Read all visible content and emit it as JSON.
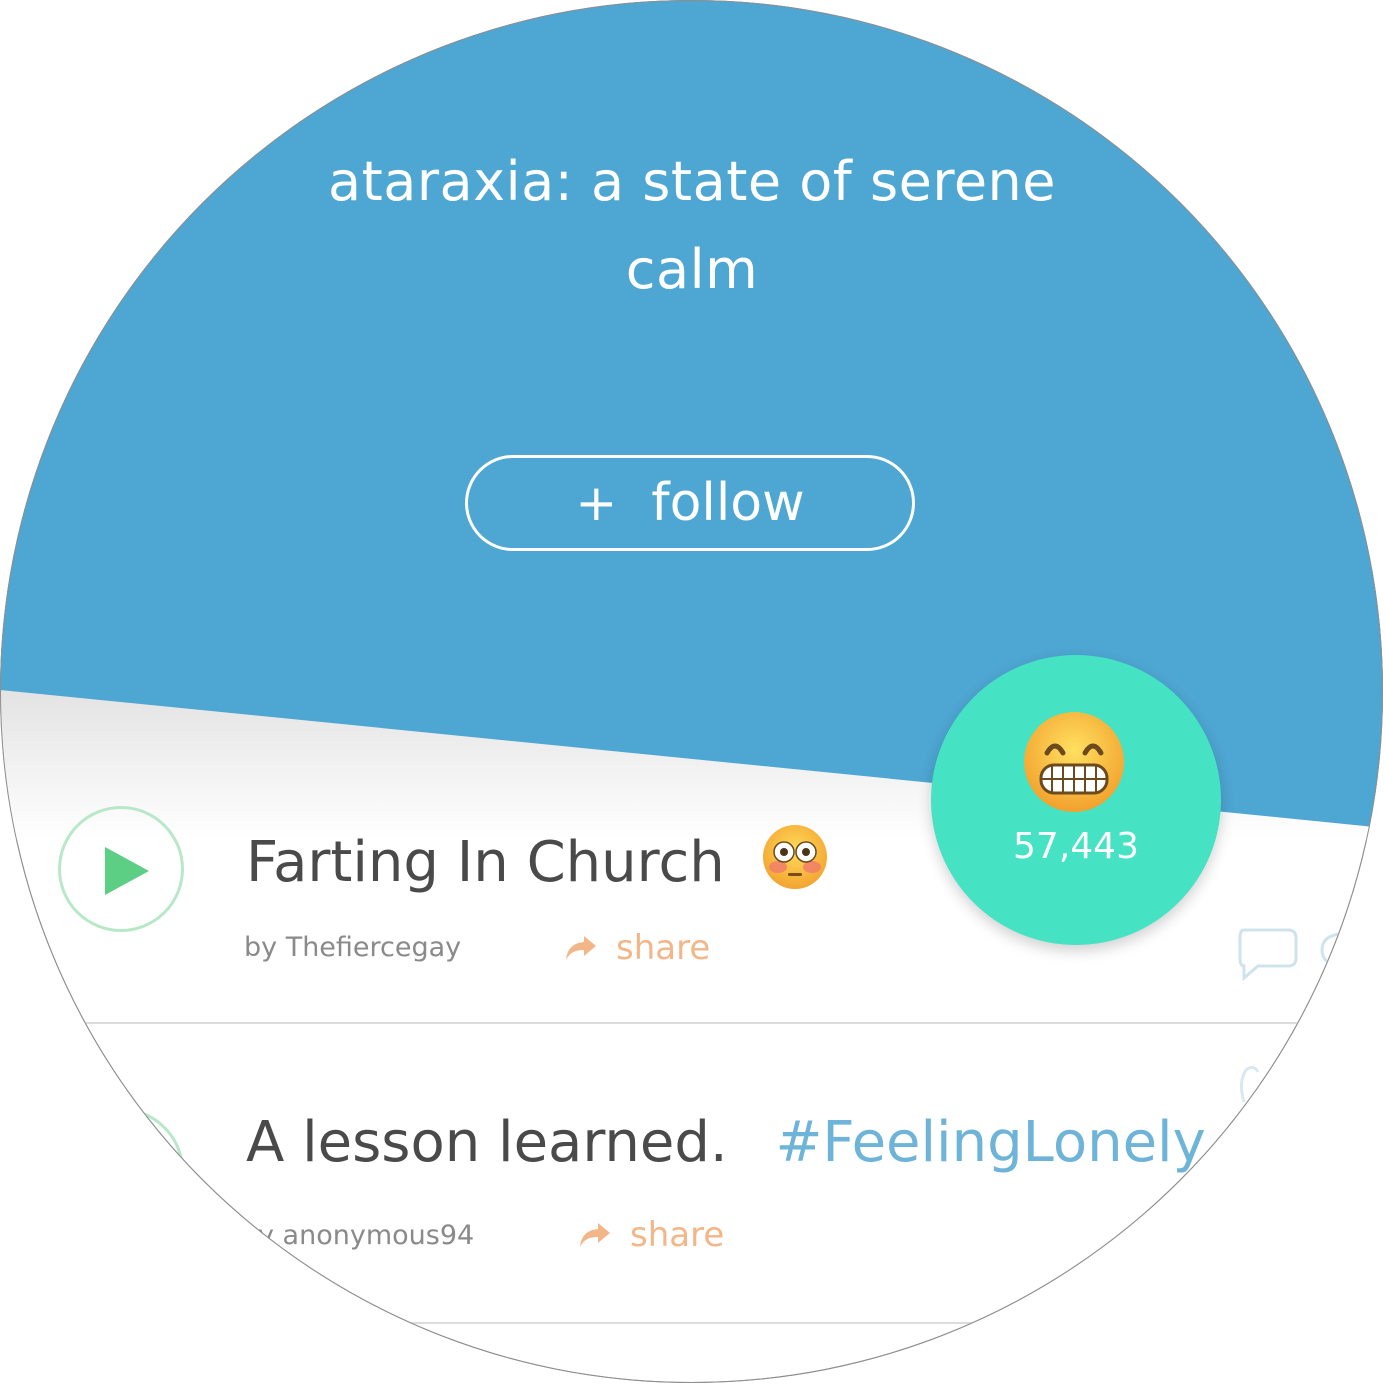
{
  "header": {
    "tagline": "ataraxia: a state of serene calm",
    "follow_button": {
      "icon": "+",
      "label": "follow"
    },
    "background_color": "#4ea6d2"
  },
  "reaction": {
    "emoji": "grinning-teeth-emoji",
    "count": "57,443",
    "color": "#45e2c4"
  },
  "posts": [
    {
      "title": "Farting In Church",
      "title_emoji": "flushed-face-emoji",
      "hashtag": "",
      "author": "by Thefiercegay",
      "share_label": "share"
    },
    {
      "title": "A lesson learned.",
      "hashtag": "#FeelingLonely",
      "author": "y anonymous94",
      "share_label": "share"
    }
  ],
  "colors": {
    "play_accent": "#5ccf85",
    "share_accent": "#f3b688",
    "hashtag": "#6db4d8",
    "title_text": "#4a4a4a"
  }
}
